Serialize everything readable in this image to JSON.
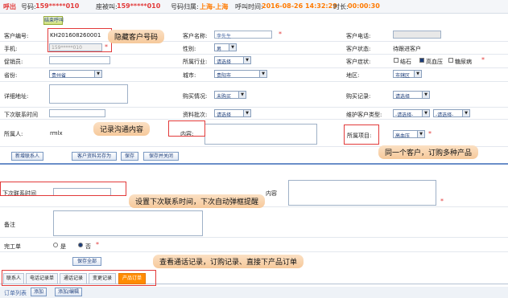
{
  "topbar": {
    "call_type": "呼出",
    "number_label": "号码:",
    "number_value": "159*****010",
    "called_label": "座被叫:",
    "called_value": "159*****010",
    "location_label": "号码归属:",
    "location_value": "上海-上海",
    "call_time_label": "呼叫时间:",
    "call_time_value": "2016-08-26 14:32:29",
    "duration_label": "时长:",
    "duration_value": "00:00:30"
  },
  "hangup_button": "结束呼叫",
  "form": {
    "customer_id_label": "客户编号:",
    "customer_id_value": "KH201608260001",
    "customer_name_label": "客户名称:",
    "customer_name_value": "李先生",
    "customer_phone_label": "客户电话:",
    "mobile_label": "手机:",
    "mobile_value": "159*****010",
    "gender_label": "性别:",
    "gender_value": "男",
    "customer_status_label": "客户状态:",
    "customer_status_value": "待跟进客户",
    "promoter_label": "促销员:",
    "industry_label": "所属行业:",
    "industry_value": "请选择",
    "symptoms_label": "客户症状:",
    "symptom_options": [
      "结石",
      "高血压",
      "糖尿病"
    ],
    "province_label": "省份:",
    "province_value": "贵州省",
    "city_label": "城市:",
    "city_value": "贵阳市",
    "district_label": "地区:",
    "district_value": "市辖区",
    "address_label": "详细地址:",
    "purchase_situation_label": "购买情况:",
    "purchase_situation_value": "未购买",
    "purchase_record_label": "购买记录:",
    "purchase_record_value": "请选择",
    "next_contact_label": "下次联系时间",
    "info_batch_label": "资料批次:",
    "info_batch_value": "请选择",
    "maintain_type_label": "维护客户类型:",
    "maintain_type_value1": "-请选择-",
    "maintain_type_value2": "-请选择-",
    "owner_label": "所属人:",
    "owner_value": "rmlx",
    "content_label": "内容:",
    "project_label": "所属项目:",
    "project_value": "高血压"
  },
  "buttons": {
    "add_contact": "新增联系人",
    "save_customer": "客户资料另存为",
    "save": "保存",
    "save_close": "保存并关闭",
    "save_all": "保存全部",
    "add": "添加",
    "add_order": "添加/编辑"
  },
  "lower_form": {
    "next_contact_label": "下次联系时间",
    "content_label": "内容",
    "note_label": "备注",
    "finish_label": "完工单",
    "yes_label": "是",
    "no_label": "否"
  },
  "tabs": [
    "联系人",
    "电话记录单",
    "通话记录",
    "变更记录",
    "产品订单"
  ],
  "order_list_label": "订单列表",
  "callouts": {
    "hide_number": "隐藏客户号码",
    "record_content": "记录沟通内容",
    "multi_product": "同一个客户，订购多种产品",
    "next_contact": "设置下次联系时间，下次自动弹框提醒",
    "view_records": "查看通话记录，订购记录、直接下产品订单"
  },
  "colors": {
    "accent_red": "#e23a3a",
    "active_tab": "#ff8c00",
    "callout": "#f6c99b"
  }
}
